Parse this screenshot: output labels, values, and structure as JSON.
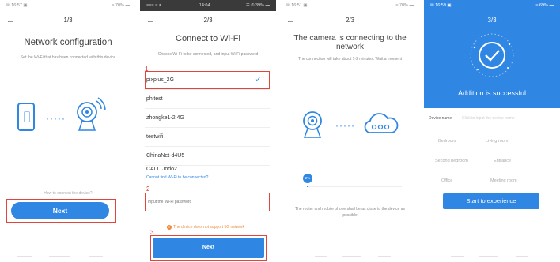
{
  "screen1": {
    "status_left": "✉ 16:57 ▣",
    "status_right": "≡ 70% ▬",
    "step": "1/3",
    "title": "Network configuration",
    "subtitle": "Set the Wi-Fi that has been connected with this device",
    "connect_link": "How to connect the device?",
    "next_label": "Next",
    "dots": "·····"
  },
  "screen2": {
    "status_left": "≡≡≡ ≡ ≢",
    "status_center": "14:04",
    "status_right": "☰ ® 39% ▬",
    "step": "2/3",
    "title": "Connect to Wi-Fi",
    "subtitle": "Choose Wi-Fi to be connected, and input Wi-Fi password",
    "label1": "1",
    "label2": "2",
    "label3": "3",
    "wifi_list": [
      "pixplus_2G",
      "phitest",
      "zhongke1-2.4G",
      "testwifi",
      "ChinaNet-d4U5",
      "CALL·Jodo2"
    ],
    "check": "✓",
    "cannot_find": "Cannot find Wi-Fi to be connected?",
    "password_placeholder": "Input the Wi-Fi password",
    "warning": "The device does not support 5G network",
    "warning_icon": "!",
    "next_label": "Next"
  },
  "screen3": {
    "status_left": "✉ 16:51 ▣",
    "status_right": "≡ 70% ▬",
    "step": "2/3",
    "title": "The camera is connecting to the network",
    "subtitle": "The connection will take about 1-2 minutes. Wait a moment",
    "dots": "·····",
    "progress_label": "2%",
    "progress_percent": 2,
    "footer": "The router and mobile phone shall be as close to the device as possible"
  },
  "screen4": {
    "status_left": "✉ 16:59 ▣",
    "status_right": "≡ 69% ▬",
    "step": "3/3",
    "success": "Addition is successful",
    "device_name_label": "Device name",
    "device_name_placeholder": "Click to input the device name",
    "rooms": [
      "Bedroom",
      "Living room",
      "Second bedroom",
      "Entrance",
      "Office",
      "Meeting room"
    ],
    "start_label": "Start to experience"
  },
  "colors": {
    "accent": "#2f86e3",
    "highlight": "#e0443a"
  }
}
